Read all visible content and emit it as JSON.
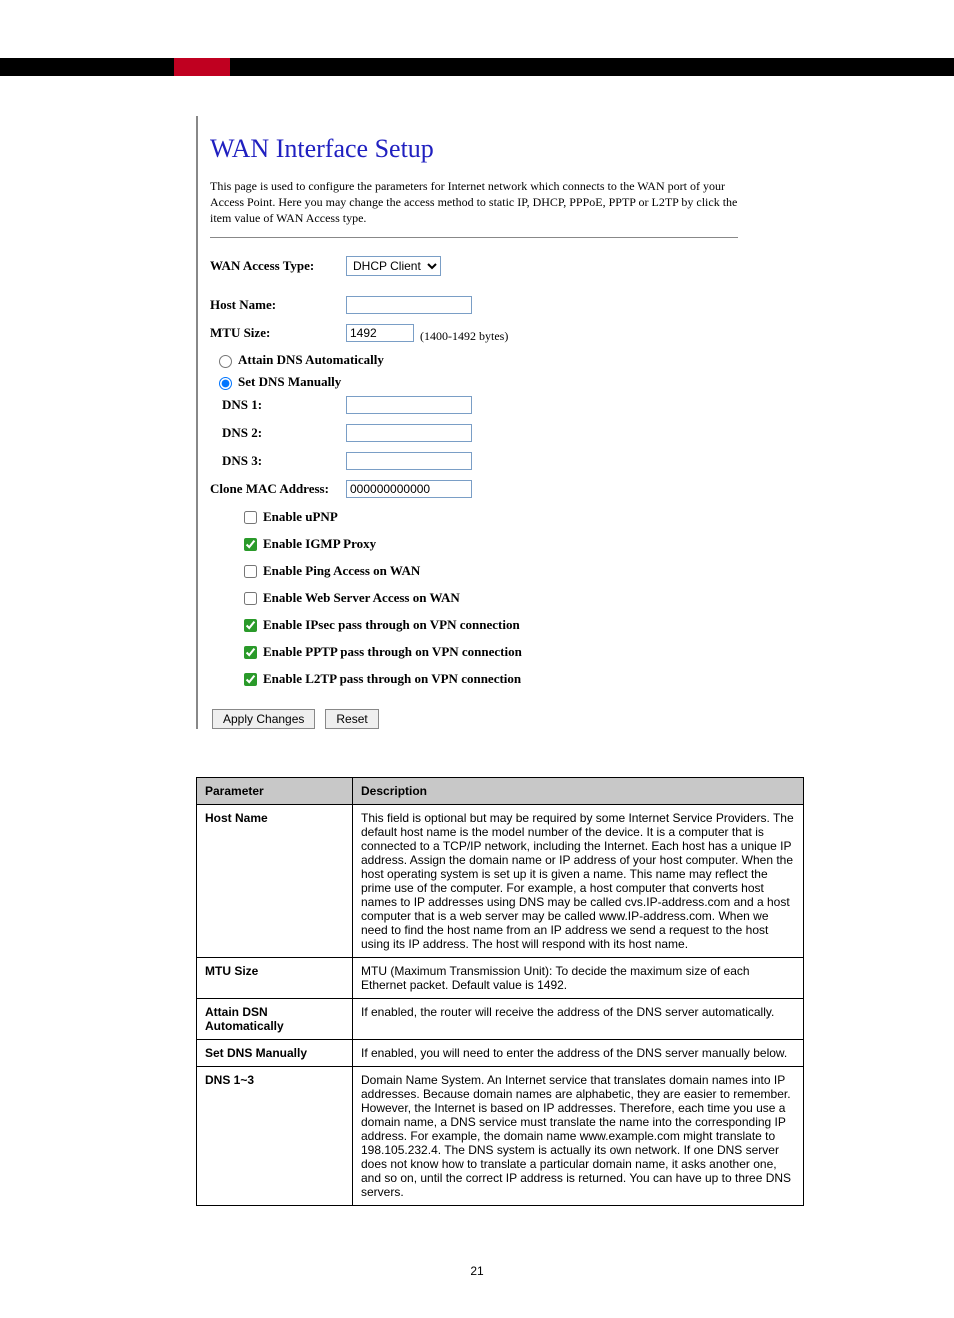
{
  "panel": {
    "title": "WAN Interface Setup",
    "description": "This page is used to configure the parameters for Internet network which connects to the WAN port of your Access Point. Here you may change the access method to static IP, DHCP, PPPoE, PPTP or L2TP by click the item value of WAN Access type.",
    "wan_access_type_label": "WAN Access Type:",
    "wan_access_type_value": "DHCP Client",
    "host_name_label": "Host Name:",
    "host_name_value": "",
    "mtu_label": "MTU Size:",
    "mtu_value": "1492",
    "mtu_hint": "(1400-1492 bytes)",
    "dns_auto_label": "Attain DNS Automatically",
    "dns_manual_label": "Set DNS Manually",
    "dns_mode_selected": "manual",
    "dns1_label": "DNS 1:",
    "dns1_value": "",
    "dns2_label": "DNS 2:",
    "dns2_value": "",
    "dns3_label": "DNS 3:",
    "dns3_value": "",
    "clone_mac_label": "Clone MAC Address:",
    "clone_mac_value": "000000000000",
    "checks": [
      {
        "label": "Enable uPNP",
        "checked": false
      },
      {
        "label": "Enable IGMP Proxy",
        "checked": true
      },
      {
        "label": "Enable Ping Access on WAN",
        "checked": false
      },
      {
        "label": "Enable Web Server Access on WAN",
        "checked": false
      },
      {
        "label": "Enable IPsec pass through on VPN connection",
        "checked": true
      },
      {
        "label": "Enable PPTP pass through on VPN connection",
        "checked": true
      },
      {
        "label": "Enable L2TP pass through on VPN connection",
        "checked": true
      }
    ],
    "apply_label": "Apply Changes",
    "reset_label": "Reset"
  },
  "table": {
    "headers": [
      "Parameter",
      "Description"
    ],
    "rows": [
      {
        "param": "Host Name",
        "desc": "This field is optional but may be required by some Internet Service Providers. The default host name is the model number of the device. It is a computer that is connected to a TCP/IP network, including the Internet. Each host has a unique IP address. Assign the domain name or IP address of your host computer. When the host operating system is set up it is given a name. This name may reflect the prime use of the computer. For example, a host computer that converts host names to IP addresses using DNS may be called cvs.IP-address.com and a host computer that is a web server may be called www.IP-address.com. When we need to find the host name from an IP address we send a request to the host using its IP address. The host will respond with its host name."
      },
      {
        "param": "MTU Size",
        "desc": "MTU (Maximum Transmission Unit): To decide the maximum size of each Ethernet packet. Default value is 1492."
      },
      {
        "param": "Attain DSN Automatically",
        "desc": "If enabled, the router will receive the address of the DNS server automatically."
      },
      {
        "param": "Set DNS Manually",
        "desc": "If enabled, you will need to enter the address of the DNS server manually below."
      },
      {
        "param": "DNS 1~3",
        "desc": "Domain Name System. An Internet service that translates domain names into IP addresses. Because domain names are alphabetic, they are easier to remember. However, the Internet is based on IP addresses. Therefore, each time you use a domain name, a DNS service must translate the name into the corresponding IP address. For example, the domain name www.example.com might translate to 198.105.232.4. The DNS system is actually its own network. If one DNS server does not know how to translate a particular domain name, it asks another one, and so on, until the correct IP address is returned. You can have up to three DNS servers."
      }
    ]
  },
  "page_number": "21"
}
